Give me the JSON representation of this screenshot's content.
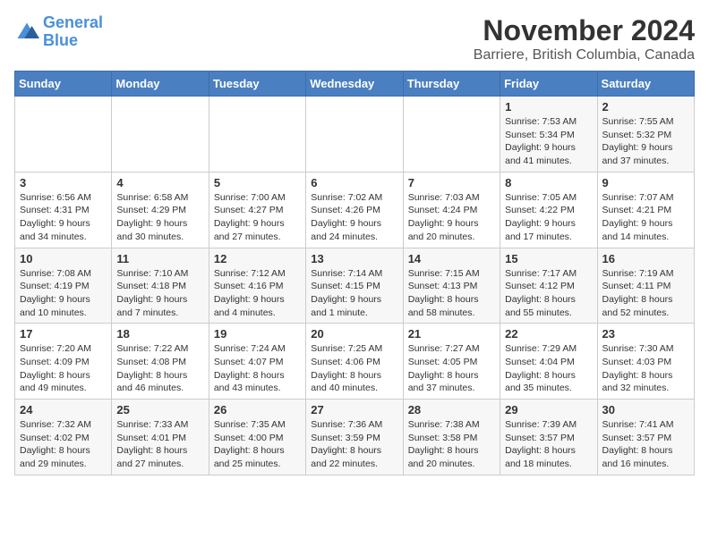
{
  "logo": {
    "line1": "General",
    "line2": "Blue"
  },
  "title": "November 2024",
  "subtitle": "Barriere, British Columbia, Canada",
  "days_of_week": [
    "Sunday",
    "Monday",
    "Tuesday",
    "Wednesday",
    "Thursday",
    "Friday",
    "Saturday"
  ],
  "weeks": [
    [
      {
        "day": "",
        "info": ""
      },
      {
        "day": "",
        "info": ""
      },
      {
        "day": "",
        "info": ""
      },
      {
        "day": "",
        "info": ""
      },
      {
        "day": "",
        "info": ""
      },
      {
        "day": "1",
        "info": "Sunrise: 7:53 AM\nSunset: 5:34 PM\nDaylight: 9 hours\nand 41 minutes."
      },
      {
        "day": "2",
        "info": "Sunrise: 7:55 AM\nSunset: 5:32 PM\nDaylight: 9 hours\nand 37 minutes."
      }
    ],
    [
      {
        "day": "3",
        "info": "Sunrise: 6:56 AM\nSunset: 4:31 PM\nDaylight: 9 hours\nand 34 minutes."
      },
      {
        "day": "4",
        "info": "Sunrise: 6:58 AM\nSunset: 4:29 PM\nDaylight: 9 hours\nand 30 minutes."
      },
      {
        "day": "5",
        "info": "Sunrise: 7:00 AM\nSunset: 4:27 PM\nDaylight: 9 hours\nand 27 minutes."
      },
      {
        "day": "6",
        "info": "Sunrise: 7:02 AM\nSunset: 4:26 PM\nDaylight: 9 hours\nand 24 minutes."
      },
      {
        "day": "7",
        "info": "Sunrise: 7:03 AM\nSunset: 4:24 PM\nDaylight: 9 hours\nand 20 minutes."
      },
      {
        "day": "8",
        "info": "Sunrise: 7:05 AM\nSunset: 4:22 PM\nDaylight: 9 hours\nand 17 minutes."
      },
      {
        "day": "9",
        "info": "Sunrise: 7:07 AM\nSunset: 4:21 PM\nDaylight: 9 hours\nand 14 minutes."
      }
    ],
    [
      {
        "day": "10",
        "info": "Sunrise: 7:08 AM\nSunset: 4:19 PM\nDaylight: 9 hours\nand 10 minutes."
      },
      {
        "day": "11",
        "info": "Sunrise: 7:10 AM\nSunset: 4:18 PM\nDaylight: 9 hours\nand 7 minutes."
      },
      {
        "day": "12",
        "info": "Sunrise: 7:12 AM\nSunset: 4:16 PM\nDaylight: 9 hours\nand 4 minutes."
      },
      {
        "day": "13",
        "info": "Sunrise: 7:14 AM\nSunset: 4:15 PM\nDaylight: 9 hours\nand 1 minute."
      },
      {
        "day": "14",
        "info": "Sunrise: 7:15 AM\nSunset: 4:13 PM\nDaylight: 8 hours\nand 58 minutes."
      },
      {
        "day": "15",
        "info": "Sunrise: 7:17 AM\nSunset: 4:12 PM\nDaylight: 8 hours\nand 55 minutes."
      },
      {
        "day": "16",
        "info": "Sunrise: 7:19 AM\nSunset: 4:11 PM\nDaylight: 8 hours\nand 52 minutes."
      }
    ],
    [
      {
        "day": "17",
        "info": "Sunrise: 7:20 AM\nSunset: 4:09 PM\nDaylight: 8 hours\nand 49 minutes."
      },
      {
        "day": "18",
        "info": "Sunrise: 7:22 AM\nSunset: 4:08 PM\nDaylight: 8 hours\nand 46 minutes."
      },
      {
        "day": "19",
        "info": "Sunrise: 7:24 AM\nSunset: 4:07 PM\nDaylight: 8 hours\nand 43 minutes."
      },
      {
        "day": "20",
        "info": "Sunrise: 7:25 AM\nSunset: 4:06 PM\nDaylight: 8 hours\nand 40 minutes."
      },
      {
        "day": "21",
        "info": "Sunrise: 7:27 AM\nSunset: 4:05 PM\nDaylight: 8 hours\nand 37 minutes."
      },
      {
        "day": "22",
        "info": "Sunrise: 7:29 AM\nSunset: 4:04 PM\nDaylight: 8 hours\nand 35 minutes."
      },
      {
        "day": "23",
        "info": "Sunrise: 7:30 AM\nSunset: 4:03 PM\nDaylight: 8 hours\nand 32 minutes."
      }
    ],
    [
      {
        "day": "24",
        "info": "Sunrise: 7:32 AM\nSunset: 4:02 PM\nDaylight: 8 hours\nand 29 minutes."
      },
      {
        "day": "25",
        "info": "Sunrise: 7:33 AM\nSunset: 4:01 PM\nDaylight: 8 hours\nand 27 minutes."
      },
      {
        "day": "26",
        "info": "Sunrise: 7:35 AM\nSunset: 4:00 PM\nDaylight: 8 hours\nand 25 minutes."
      },
      {
        "day": "27",
        "info": "Sunrise: 7:36 AM\nSunset: 3:59 PM\nDaylight: 8 hours\nand 22 minutes."
      },
      {
        "day": "28",
        "info": "Sunrise: 7:38 AM\nSunset: 3:58 PM\nDaylight: 8 hours\nand 20 minutes."
      },
      {
        "day": "29",
        "info": "Sunrise: 7:39 AM\nSunset: 3:57 PM\nDaylight: 8 hours\nand 18 minutes."
      },
      {
        "day": "30",
        "info": "Sunrise: 7:41 AM\nSunset: 3:57 PM\nDaylight: 8 hours\nand 16 minutes."
      }
    ]
  ]
}
